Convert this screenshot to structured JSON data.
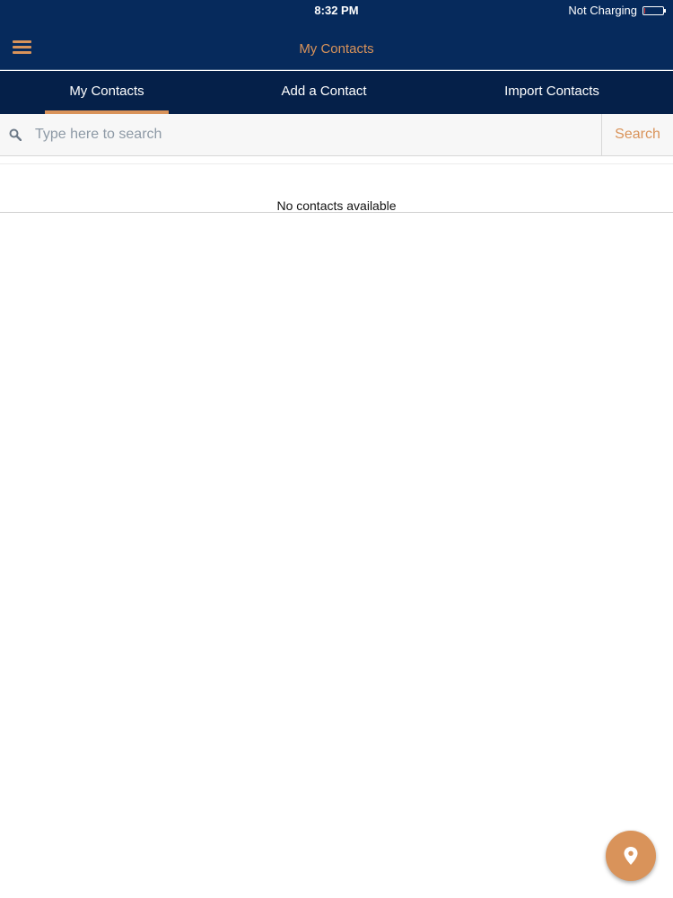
{
  "status_bar": {
    "time": "8:32 PM",
    "battery_status": "Not Charging"
  },
  "header": {
    "title": "My Contacts",
    "menu_icon": "hamburger-menu-icon"
  },
  "tabs": [
    {
      "label": "My Contacts",
      "active": true
    },
    {
      "label": "Add a Contact",
      "active": false
    },
    {
      "label": "Import Contacts",
      "active": false
    }
  ],
  "search": {
    "placeholder": "Type here to search",
    "value": "",
    "button_label": "Search",
    "icon": "search-icon"
  },
  "contacts": {
    "empty_message": "No contacts available",
    "items": []
  },
  "fab": {
    "icon": "location-pin-icon"
  },
  "colors": {
    "primary": "#062a5c",
    "tab_bar": "#052049",
    "accent": "#d9935a",
    "background": "#ffffff"
  }
}
